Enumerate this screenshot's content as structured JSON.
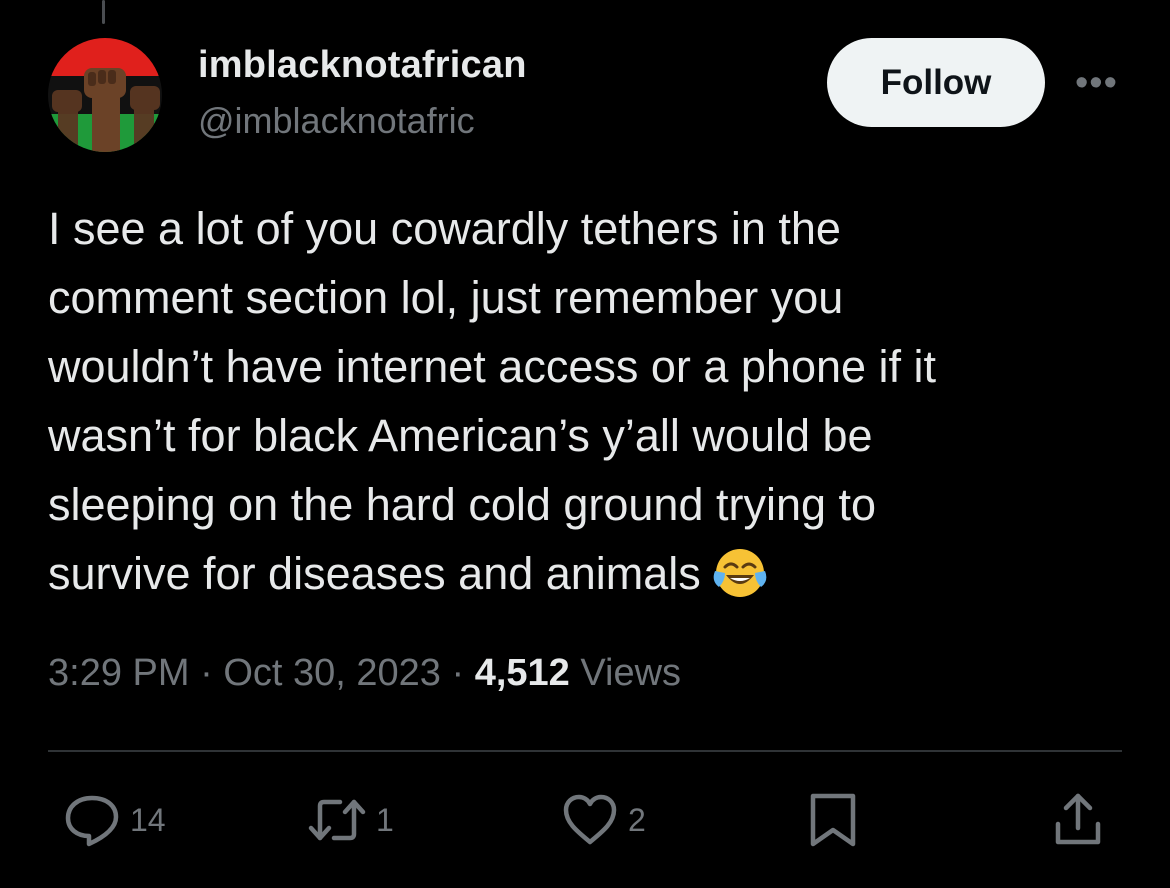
{
  "author": {
    "display_name": "imblacknotafrican",
    "handle": "@imblacknotafric",
    "avatar_icon": "raised-fists-flag-avatar"
  },
  "header": {
    "follow_label": "Follow",
    "more_label": "•••"
  },
  "tweet": {
    "lines": [
      "I see a lot of you cowardly tethers in the",
      "comment section lol, just remember you",
      "wouldn’t have internet access or a phone if it",
      "wasn’t for black American’s y’all would be",
      "sleeping on the hard cold ground trying to",
      "survive for diseases and animals"
    ],
    "emoji": "face-with-tears-of-joy"
  },
  "meta": {
    "time": "3:29 PM",
    "sep1": " · ",
    "date": "Oct 30, 2023",
    "sep2": " · ",
    "views_count": "4,512",
    "views_label": " Views"
  },
  "actions": {
    "replies": "14",
    "reposts": "1",
    "likes": "2"
  },
  "colors": {
    "background": "#000000",
    "text": "#e7e9ea",
    "muted": "#71767b",
    "follow_bg": "#eff3f4",
    "divider": "#2f3336"
  }
}
